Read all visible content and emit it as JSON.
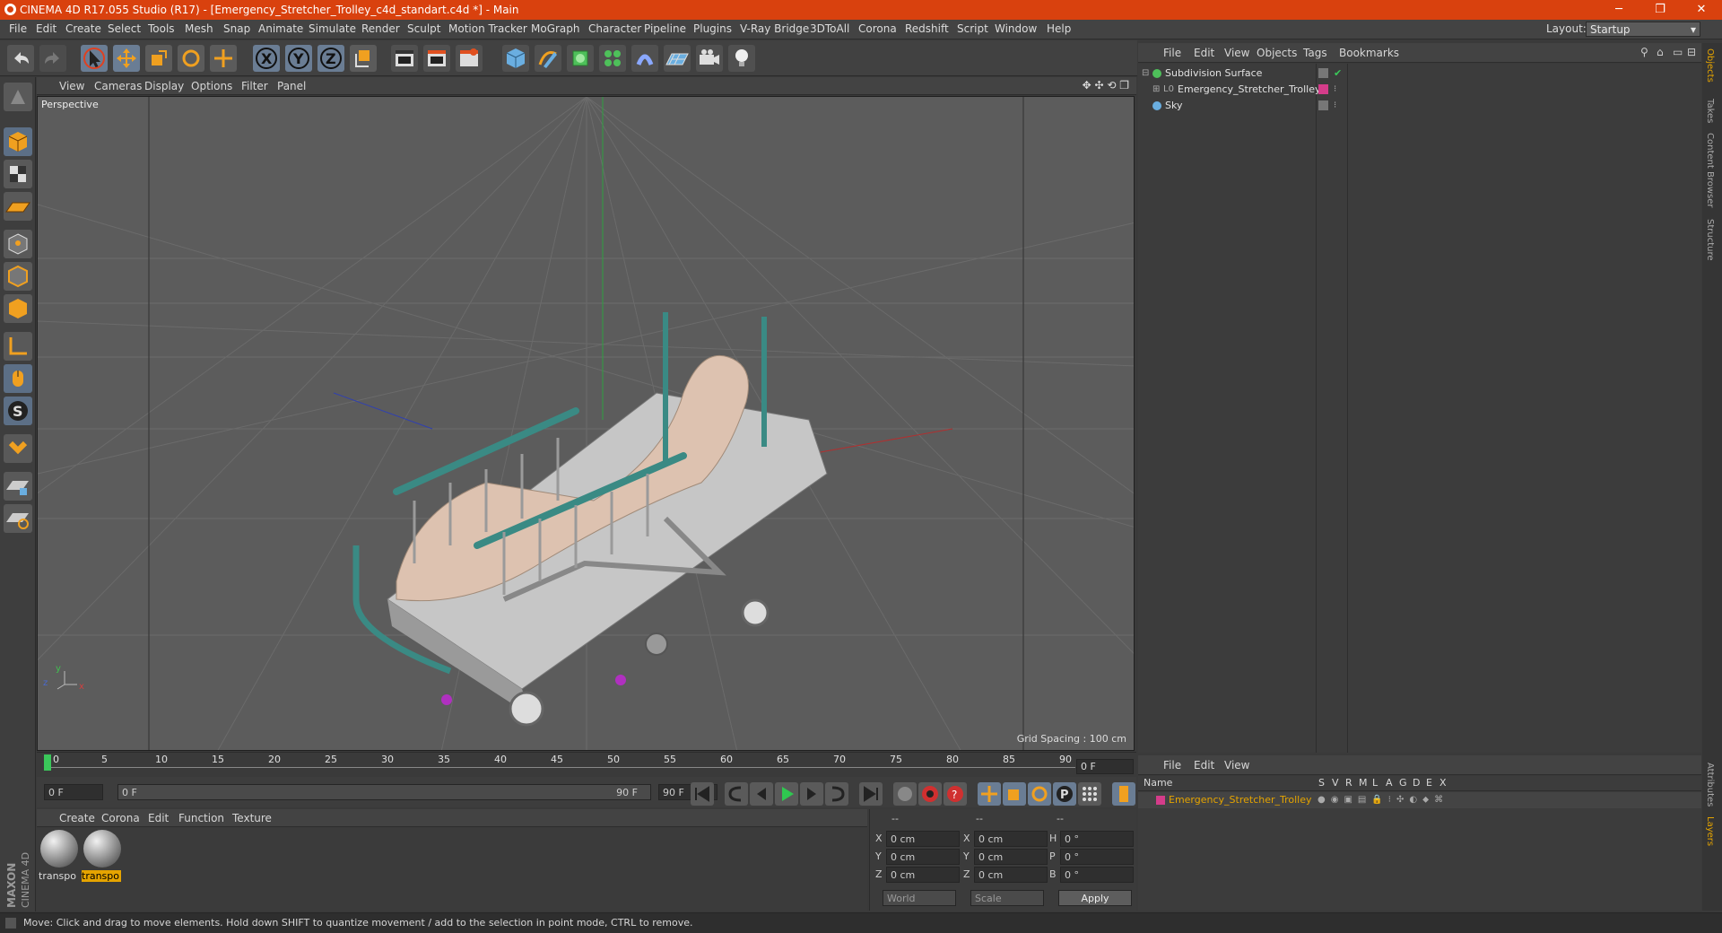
{
  "window": {
    "title": "CINEMA 4D R17.055 Studio (R17) - [Emergency_Stretcher_Trolley_c4d_standart.c4d *] - Main",
    "minimize": "─",
    "restore": "❐",
    "close": "✕"
  },
  "menubar": {
    "items": [
      "File",
      "Edit",
      "Create",
      "Select",
      "Tools",
      "Mesh",
      "Snap",
      "Animate",
      "Simulate",
      "Render",
      "Sculpt",
      "Motion Tracker",
      "MoGraph",
      "Character",
      "Pipeline",
      "Plugins",
      "V-Ray Bridge",
      "3DToAll",
      "Corona",
      "Redshift",
      "Script",
      "Window",
      "Help"
    ],
    "layout_label": "Layout:",
    "layout_value": "Startup"
  },
  "viewport": {
    "menu": [
      "View",
      "Cameras",
      "Display",
      "Options",
      "Filter",
      "Panel"
    ],
    "label": "Perspective",
    "grid_spacing": "Grid Spacing : 100 cm",
    "axis_x": "x",
    "axis_y": "y",
    "axis_z": "z"
  },
  "timeline": {
    "ticks": [
      "0",
      "5",
      "10",
      "15",
      "20",
      "25",
      "30",
      "35",
      "40",
      "45",
      "50",
      "55",
      "60",
      "65",
      "70",
      "75",
      "80",
      "85",
      "90"
    ],
    "current_frame": "0 F",
    "start": "0 F",
    "range_start": "0 F",
    "range_end": "90 F",
    "end": "90 F"
  },
  "materials": {
    "menu": [
      "Create",
      "Corona",
      "Edit",
      "Function",
      "Texture"
    ],
    "items": [
      {
        "label": "transpo",
        "selected": false
      },
      {
        "label": "transpo",
        "selected": true
      }
    ]
  },
  "coordinates": {
    "headers": [
      "--",
      "--",
      "--"
    ],
    "rows": [
      {
        "a": "X",
        "av": "0 cm",
        "b": "X",
        "bv": "0 cm",
        "c": "H",
        "cv": "0 °"
      },
      {
        "a": "Y",
        "av": "0 cm",
        "b": "Y",
        "bv": "0 cm",
        "c": "P",
        "cv": "0 °"
      },
      {
        "a": "Z",
        "av": "0 cm",
        "b": "Z",
        "bv": "0 cm",
        "c": "B",
        "cv": "0 °"
      }
    ],
    "mode": "World",
    "scale": "Scale",
    "apply": "Apply"
  },
  "objects": {
    "menu": [
      "File",
      "Edit",
      "View",
      "Objects",
      "Tags",
      "Bookmarks"
    ],
    "items": [
      {
        "name": "Subdivision Surface",
        "indent": 0
      },
      {
        "name": "Emergency_Stretcher_Trolley",
        "indent": 1
      },
      {
        "name": "Sky",
        "indent": 0
      }
    ]
  },
  "layers": {
    "menu": [
      "File",
      "Edit",
      "View"
    ],
    "header_name": "Name",
    "columns": [
      "S",
      "V",
      "R",
      "M",
      "L",
      "A",
      "G",
      "D",
      "E",
      "X"
    ],
    "items": [
      {
        "name": "Emergency_Stretcher_Trolley"
      }
    ]
  },
  "right_tabs": [
    "Objects",
    "Takes",
    "Content Browser",
    "Structure",
    "Attributes",
    "Layers"
  ],
  "status": "Move: Click and drag to move elements. Hold down SHIFT to quantize movement / add to the selection in point mode, CTRL to remove.",
  "brand": {
    "line1": "MAXON",
    "line2": "CINEMA 4D"
  },
  "colors": {
    "title_bar": "#d9410e",
    "accent": "#e5a400",
    "layer_color": "#d43c8a"
  }
}
